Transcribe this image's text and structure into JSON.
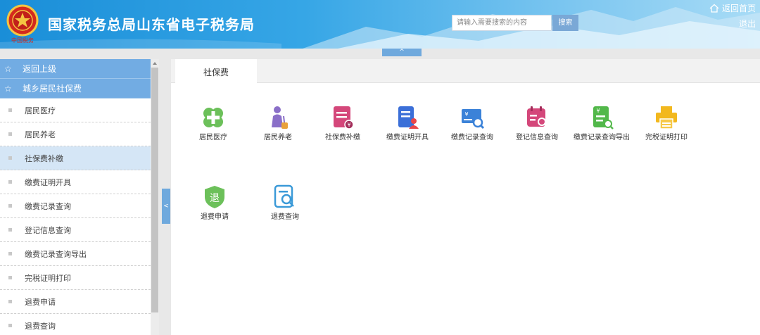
{
  "header": {
    "title": "国家税务总局山东省电子税务局",
    "emblem_text": "中国税务",
    "search_placeholder": "请输入需要搜索的内容",
    "search_button": "搜索",
    "home_link": "返回首页",
    "logout": "退出"
  },
  "collapse_top": "^",
  "collapse_side": "<",
  "sidebar": {
    "back": "返回上级",
    "section": "城乡居民社保费",
    "items": [
      {
        "label": "居民医疗"
      },
      {
        "label": "居民养老"
      },
      {
        "label": "社保费补缴"
      },
      {
        "label": "缴费证明开具"
      },
      {
        "label": "缴费记录查询"
      },
      {
        "label": "登记信息查询"
      },
      {
        "label": "缴费记录查询导出"
      },
      {
        "label": "完税证明打印"
      },
      {
        "label": "退费申请"
      },
      {
        "label": "退费查询"
      }
    ],
    "active_item": "社保费补缴"
  },
  "main": {
    "tab": "社保费",
    "tiles": [
      {
        "label": "居民医疗",
        "icon": "medical-cross-icon",
        "color": "#6cc05a"
      },
      {
        "label": "居民养老",
        "icon": "elderly-person-icon",
        "color": "#8a6fc8"
      },
      {
        "label": "社保费补缴",
        "icon": "payment-document-icon",
        "color": "#d4477a"
      },
      {
        "label": "缴费证明开具",
        "icon": "certificate-user-icon",
        "color": "#3b6fd8"
      },
      {
        "label": "缴费记录查询",
        "icon": "payment-record-search-icon",
        "color": "#3b82d8"
      },
      {
        "label": "登记信息查询",
        "icon": "registration-search-icon",
        "color": "#d4477a"
      },
      {
        "label": "缴费记录查询导出",
        "icon": "record-export-icon",
        "color": "#52b84a"
      },
      {
        "label": "完税证明打印",
        "icon": "printer-icon",
        "color": "#f2b81e"
      },
      {
        "label": "退费申请",
        "icon": "refund-shield-icon",
        "color": "#6cc05a",
        "glyph": "退"
      },
      {
        "label": "退费查询",
        "icon": "document-search-icon",
        "color": "#3b9ad8"
      }
    ]
  }
}
